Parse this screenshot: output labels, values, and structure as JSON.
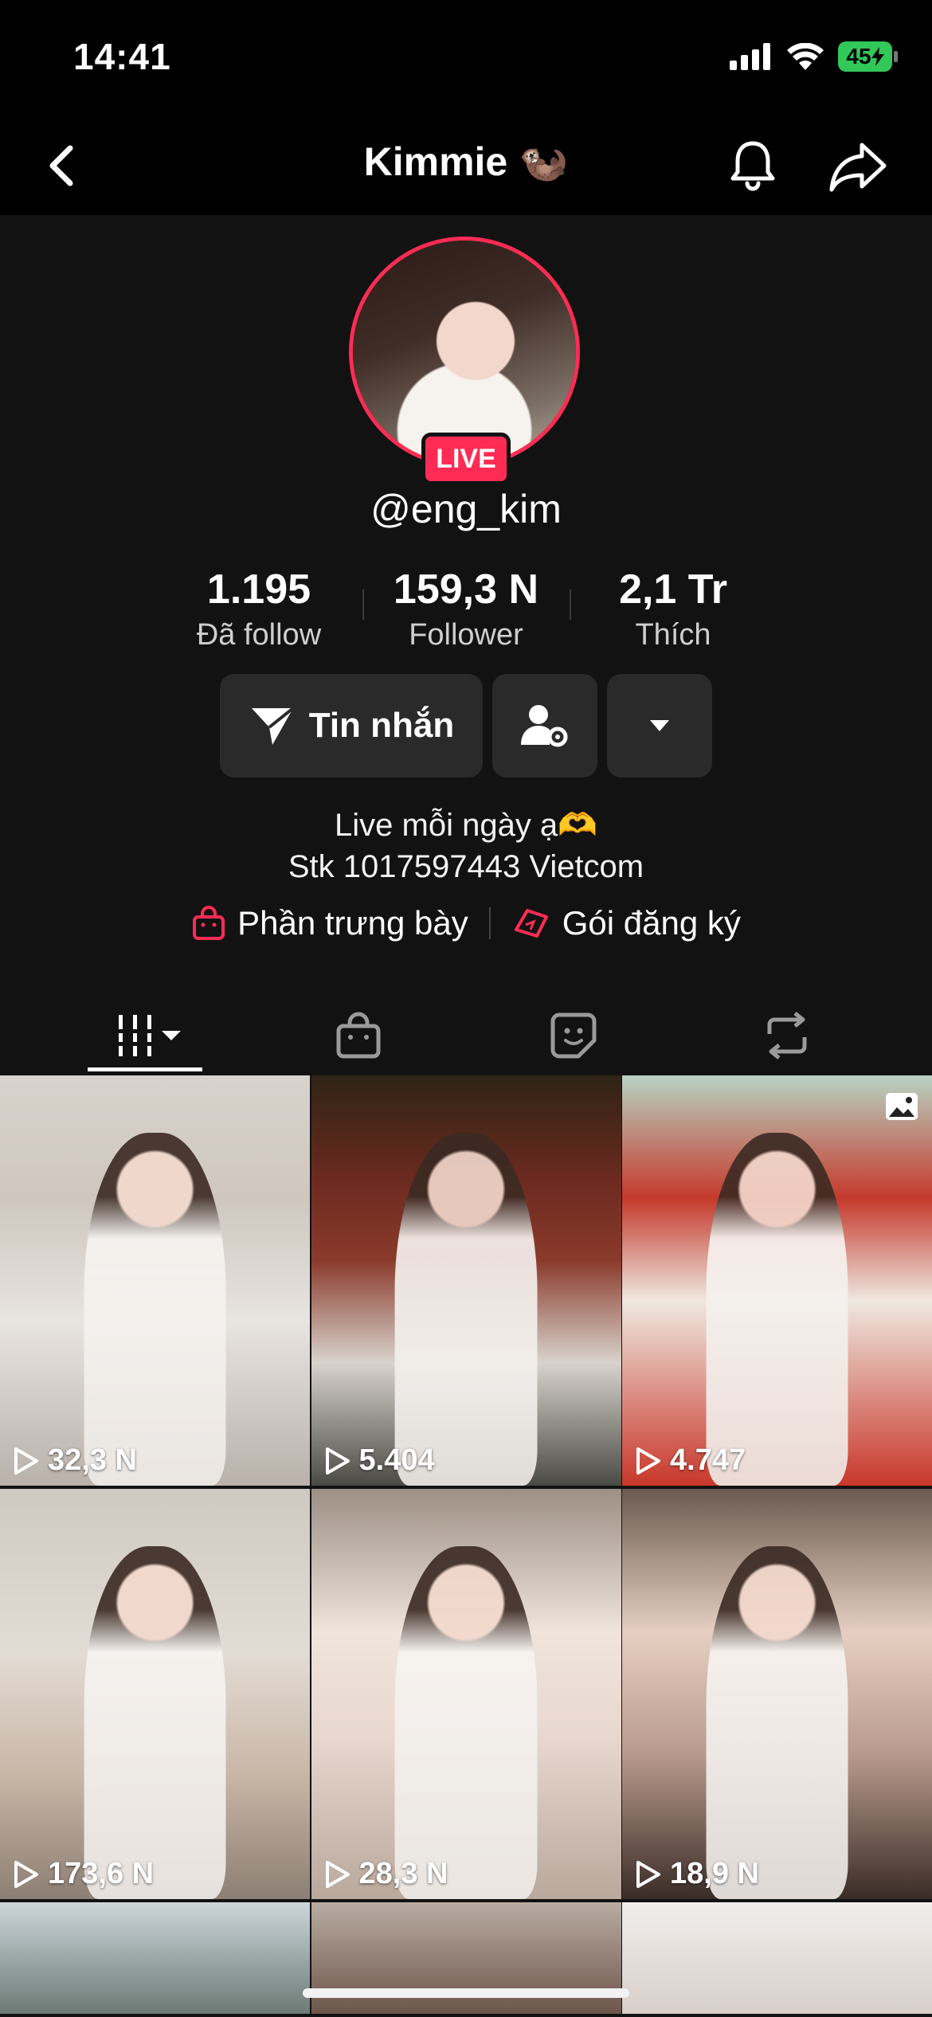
{
  "status_bar": {
    "time": "14:41",
    "battery": "45"
  },
  "nav": {
    "title": "Kimmie 🦦"
  },
  "profile": {
    "live_label": "LIVE",
    "username": "@eng_kim",
    "stats": [
      {
        "value": "1.195",
        "label": "Đã follow"
      },
      {
        "value": "159,3 N",
        "label": "Follower"
      },
      {
        "value": "2,1 Tr",
        "label": "Thích"
      }
    ],
    "message_button": "Tin nhắn",
    "bio_line1": "Live mỗi ngày ạ🫶",
    "bio_line2": "Stk 1017597443 Vietcom",
    "link_showcase": "Phần trưng bày",
    "link_subscription": "Gói đăng ký"
  },
  "videos": [
    {
      "views": "32,3 N"
    },
    {
      "views": "5.404"
    },
    {
      "views": "4.747",
      "is_photo": true
    },
    {
      "views": "173,6 N"
    },
    {
      "views": "28,3 N"
    },
    {
      "views": "18,9 N"
    }
  ],
  "colors": {
    "accent": "#fe2c55",
    "background": "#121212",
    "button": "#2a2a2a"
  }
}
